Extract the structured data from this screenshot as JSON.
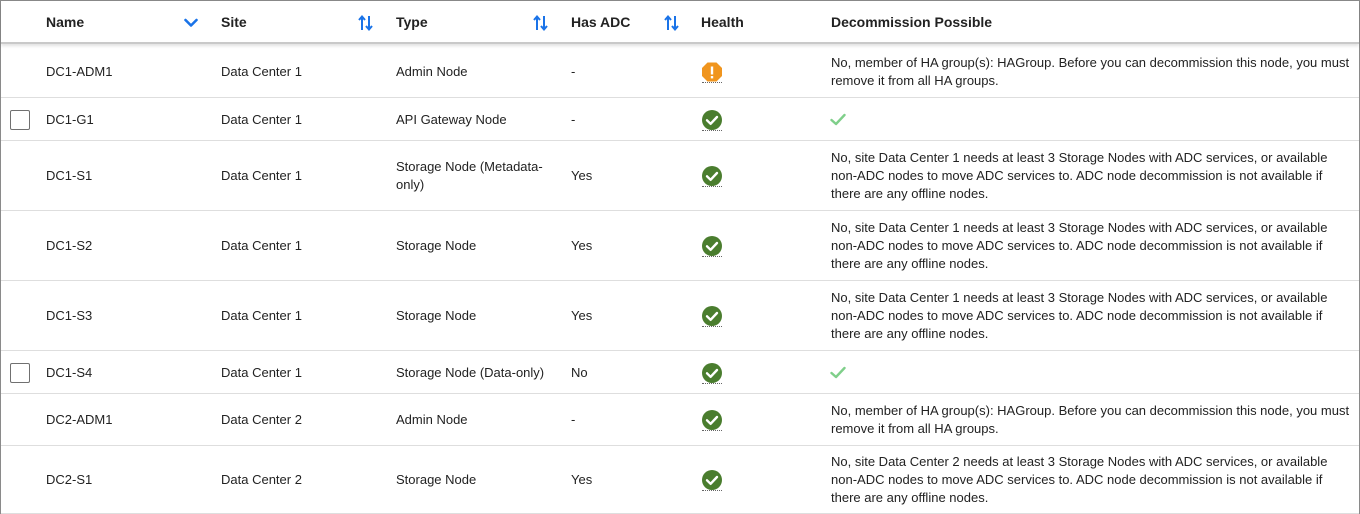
{
  "table": {
    "columns": {
      "name": "Name",
      "site": "Site",
      "type": "Type",
      "has_adc": "Has ADC",
      "health": "Health",
      "decommission": "Decommission Possible"
    },
    "colors": {
      "sort_icon": "#1a73e8",
      "health_ok": "#4a7d2e",
      "health_warning": "#f0951e",
      "decommission_ok": "#7fcf8a"
    },
    "rows": [
      {
        "name": "DC1-ADM1",
        "site": "Data Center 1",
        "type": "Admin Node",
        "has_adc": "-",
        "health": "warning",
        "selectable": false,
        "decommission": "No, member of HA group(s): HAGroup. Before you can decommission this node, you must remove it from all HA groups."
      },
      {
        "name": "DC1-G1",
        "site": "Data Center 1",
        "type": "API Gateway Node",
        "has_adc": "-",
        "health": "ok",
        "selectable": true,
        "decommission": ""
      },
      {
        "name": "DC1-S1",
        "site": "Data Center 1",
        "type": "Storage Node (Metadata-only)",
        "has_adc": "Yes",
        "health": "ok",
        "selectable": false,
        "decommission": "No, site Data Center 1 needs at least 3 Storage Nodes with ADC services, or available non-ADC nodes to move ADC services to. ADC node decommission is not available if there are any offline nodes."
      },
      {
        "name": "DC1-S2",
        "site": "Data Center 1",
        "type": "Storage Node",
        "has_adc": "Yes",
        "health": "ok",
        "selectable": false,
        "decommission": "No, site Data Center 1 needs at least 3 Storage Nodes with ADC services, or available non-ADC nodes to move ADC services to. ADC node decommission is not available if there are any offline nodes."
      },
      {
        "name": "DC1-S3",
        "site": "Data Center 1",
        "type": "Storage Node",
        "has_adc": "Yes",
        "health": "ok",
        "selectable": false,
        "decommission": "No, site Data Center 1 needs at least 3 Storage Nodes with ADC services, or available non-ADC nodes to move ADC services to. ADC node decommission is not available if there are any offline nodes."
      },
      {
        "name": "DC1-S4",
        "site": "Data Center 1",
        "type": "Storage Node (Data-only)",
        "has_adc": "No",
        "health": "ok",
        "selectable": true,
        "decommission": ""
      },
      {
        "name": "DC2-ADM1",
        "site": "Data Center 2",
        "type": "Admin Node",
        "has_adc": "-",
        "health": "ok",
        "selectable": false,
        "decommission": "No, member of HA group(s): HAGroup. Before you can decommission this node, you must remove it from all HA groups."
      },
      {
        "name": "DC2-S1",
        "site": "Data Center 2",
        "type": "Storage Node",
        "has_adc": "Yes",
        "health": "ok",
        "selectable": false,
        "decommission": "No, site Data Center 2 needs at least 3 Storage Nodes with ADC services, or available non-ADC nodes to move ADC services to. ADC node decommission is not available if there are any offline nodes."
      }
    ]
  }
}
